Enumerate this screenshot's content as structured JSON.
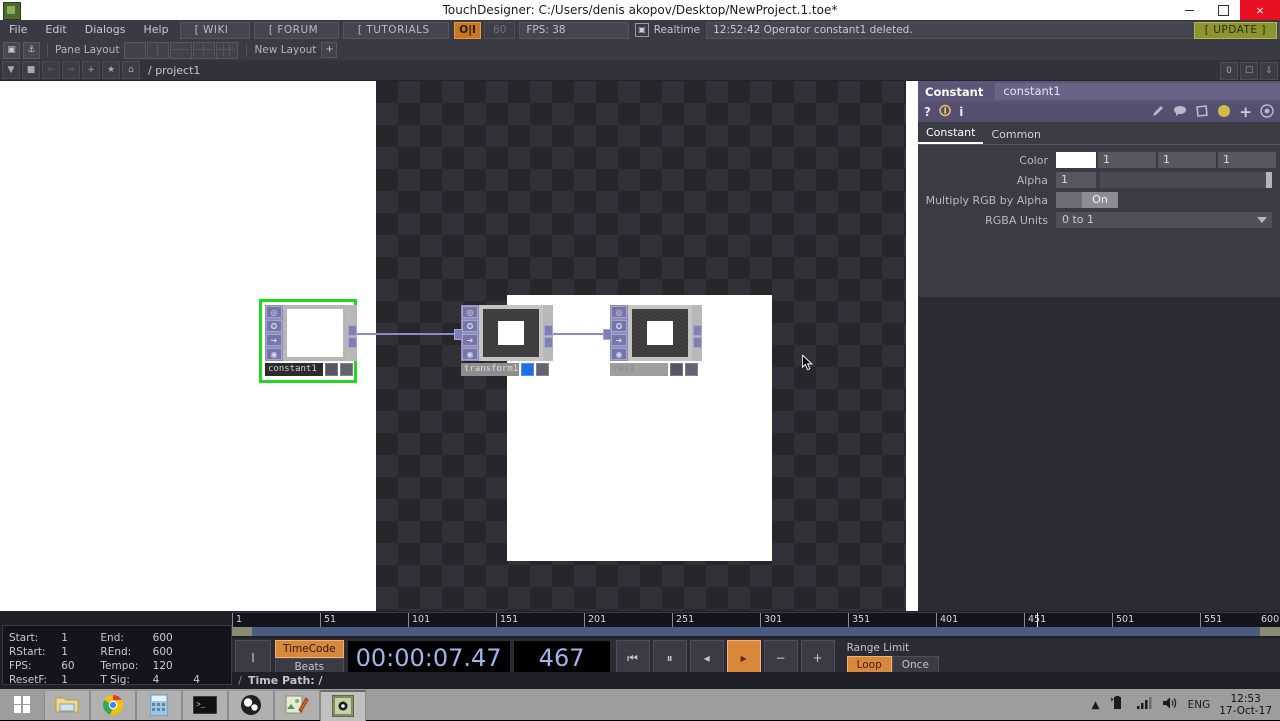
{
  "window": {
    "title": "TouchDesigner: C:/Users/denis akopov/Desktop/NewProject.1.toe*",
    "icon": "touchdesigner-icon",
    "minimize": "minimize-icon",
    "maximize": "maximize-icon",
    "close": "×"
  },
  "menu": {
    "items": [
      "File",
      "Edit",
      "Dialogs",
      "Help"
    ],
    "links": [
      "[ WIKI ]",
      "[ FORUM ]",
      "[ TUTORIALS ]"
    ],
    "oi_toggle": "O|I",
    "target_fps": "60",
    "fps_label": "FPS:  38",
    "realtime": "Realtime",
    "status": "12:52:42 Operator constant1 deleted.",
    "update": "[ UPDATE ]"
  },
  "panebar": {
    "pane_layout_label": "Pane Layout",
    "new_layout_label": "New Layout",
    "add": "+"
  },
  "pathbar": {
    "path": "/ project1",
    "right_value": "0"
  },
  "network": {
    "nodes": [
      {
        "name": "constant1",
        "selected": true
      },
      {
        "name": "transform1",
        "selected": false
      },
      {
        "name": "res1",
        "selected": false
      }
    ]
  },
  "parameters": {
    "operator_type": "Constant",
    "operator_name": "constant1",
    "help_icon": "?",
    "info_icon": "i",
    "tabs": [
      {
        "label": "Constant",
        "active": true
      },
      {
        "label": "Common",
        "active": false
      }
    ],
    "rows": [
      {
        "label": "Color",
        "swatch": "#ffffff",
        "values": [
          "1",
          "1",
          "1"
        ]
      },
      {
        "label": "Alpha",
        "value": "1"
      },
      {
        "label": "Multiply RGB by Alpha",
        "toggle": "On"
      },
      {
        "label": "RGBA Units",
        "value": "0 to 1"
      }
    ]
  },
  "timeline": {
    "info": [
      {
        "k": "Start:",
        "v": "1",
        "k2": "End:",
        "v2": "600"
      },
      {
        "k": "RStart:",
        "v": "1",
        "k2": "REnd:",
        "v2": "600"
      },
      {
        "k": "FPS:",
        "v": "60",
        "k2": "Tempo:",
        "v2": "120"
      },
      {
        "k": "ResetF:",
        "v": "1",
        "k2": "T Sig:",
        "v2": "4",
        "v3": "4"
      }
    ],
    "ruler_ticks": [
      "1",
      "51",
      "101",
      "151",
      "201",
      "251",
      "301",
      "351",
      "401",
      "451",
      "501",
      "551",
      "600"
    ],
    "mode_timecode": "TimeCode",
    "mode_beats": "Beats",
    "timecode": "00:00:07.47",
    "frame": "467",
    "transport": [
      "⏮",
      "⏸",
      "◂",
      "▸",
      "−",
      "+"
    ],
    "range_limit_label": "Range Limit",
    "loop": "Loop",
    "once": "Once",
    "time_path_label": "Time Path: /"
  },
  "taskbar": {
    "start": "start-button",
    "items": [
      "file-explorer",
      "google-chrome",
      "calculator",
      "command-prompt",
      "obs-studio",
      "image-editor",
      "touchdesigner"
    ],
    "language": "ENG",
    "time": "12:53",
    "date": "17-Oct-17"
  }
}
